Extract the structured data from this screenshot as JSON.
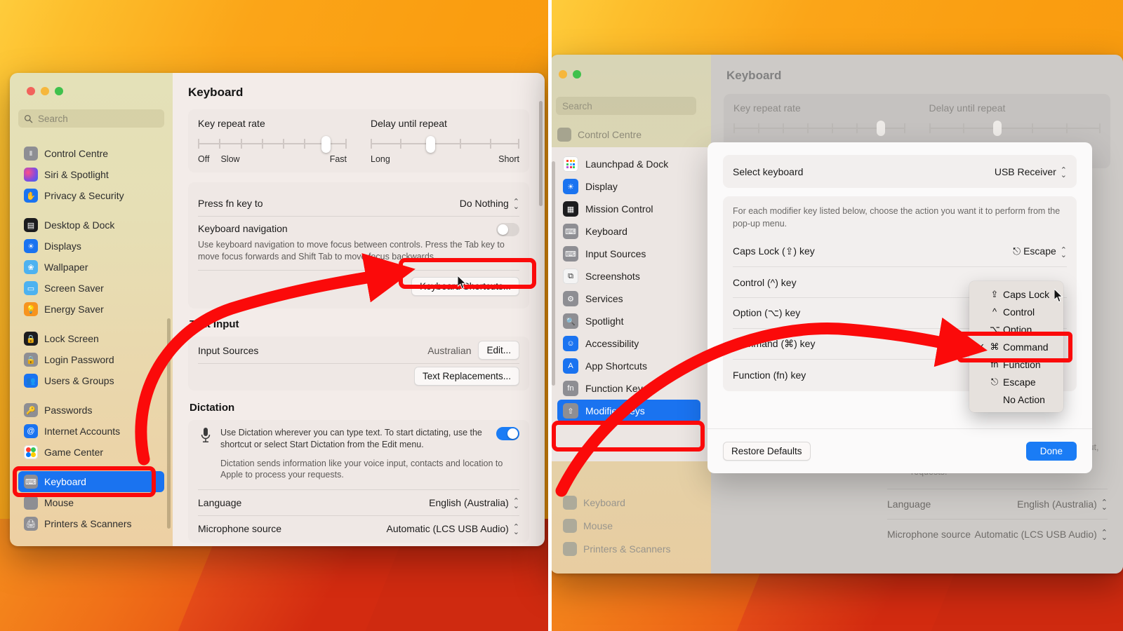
{
  "left_window": {
    "search": {
      "placeholder": "Search"
    },
    "sidebar_items": [
      {
        "label": "Control Centre",
        "icon": "control-centre-icon",
        "color": "#8e8e93"
      },
      {
        "label": "Siri & Spotlight",
        "icon": "siri-icon",
        "color": "#7a4fd8"
      },
      {
        "label": "Privacy & Security",
        "icon": "privacy-hand-icon",
        "color": "#1a73f0"
      },
      {
        "label": "Desktop & Dock",
        "icon": "desktop-dock-icon",
        "color": "#1c1c1e"
      },
      {
        "label": "Displays",
        "icon": "displays-icon",
        "color": "#1a73f0"
      },
      {
        "label": "Wallpaper",
        "icon": "wallpaper-icon",
        "color": "#4db2f0"
      },
      {
        "label": "Screen Saver",
        "icon": "screen-saver-icon",
        "color": "#4db2f0"
      },
      {
        "label": "Energy Saver",
        "icon": "energy-saver-icon",
        "color": "#f7941e"
      },
      {
        "label": "Lock Screen",
        "icon": "lock-screen-icon",
        "color": "#1c1c1e"
      },
      {
        "label": "Login Password",
        "icon": "login-password-icon",
        "color": "#8e8e93"
      },
      {
        "label": "Users & Groups",
        "icon": "users-groups-icon",
        "color": "#1a73f0"
      },
      {
        "label": "Passwords",
        "icon": "passwords-key-icon",
        "color": "#8e8e93"
      },
      {
        "label": "Internet Accounts",
        "icon": "internet-accounts-icon",
        "color": "#1a73f0"
      },
      {
        "label": "Game Center",
        "icon": "game-center-icon",
        "color": "#ffffff"
      },
      {
        "label": "Keyboard",
        "icon": "keyboard-icon",
        "color": "#8e8e93",
        "selected": true
      },
      {
        "label": "Mouse",
        "icon": "mouse-icon",
        "color": "#8e8e93"
      },
      {
        "label": "Printers & Scanners",
        "icon": "printers-scanners-icon",
        "color": "#8e8e93"
      }
    ],
    "page_title": "Keyboard",
    "key_repeat": {
      "title": "Key repeat rate",
      "ticks": 8,
      "thumb_index": 6,
      "label_off": "Off",
      "label_slow": "Slow",
      "label_fast": "Fast"
    },
    "delay_repeat": {
      "title": "Delay until repeat",
      "ticks": 6,
      "thumb_index": 2,
      "label_long": "Long",
      "label_short": "Short"
    },
    "press_fn": {
      "label": "Press fn key to",
      "value": "Do Nothing"
    },
    "keyboard_navigation": {
      "label": "Keyboard navigation",
      "description": "Use keyboard navigation to move focus between controls. Press the Tab key to move focus forwards and Shift Tab to move focus backwards.",
      "toggle_state": "off"
    },
    "keyboard_shortcuts_button": "Keyboard Shortcuts...",
    "text_input": {
      "heading": "Text Input",
      "input_sources_label": "Input Sources",
      "input_sources_value": "Australian",
      "edit_button": "Edit...",
      "text_replacements_button": "Text Replacements..."
    },
    "dictation": {
      "heading": "Dictation",
      "description": "Use Dictation wherever you can type text. To start dictating, use the shortcut or select Start Dictation from the Edit menu.",
      "privacy_note": "Dictation sends information like your voice input, contacts and location to Apple to process your requests.",
      "toggle_state": "on",
      "language_label": "Language",
      "language_value": "English (Australia)",
      "mic_label": "Microphone source",
      "mic_value": "Automatic (LCS USB Audio)"
    }
  },
  "right_window": {
    "search": {
      "placeholder": "Search"
    },
    "dim_sidebar_top": "Control Centre",
    "dim_sidebar_bottom": [
      "Keyboard",
      "Mouse",
      "Printers & Scanners"
    ],
    "page_title": "Keyboard",
    "key_repeat_title": "Key repeat rate",
    "delay_repeat_title": "Delay until repeat",
    "background_bottom": {
      "privacy_note": "Dictation sends information like your voice input, contacts and location to Apple to process your requests.",
      "language_label": "Language",
      "language_value": "English (Australia)",
      "mic_label": "Microphone source",
      "mic_value": "Automatic (LCS USB Audio)"
    },
    "category_items": [
      {
        "label": "Launchpad & Dock",
        "icon": "launchpad-dock-icon",
        "color": "#ffffff"
      },
      {
        "label": "Display",
        "icon": "display-icon",
        "color": "#1a73f0"
      },
      {
        "label": "Mission Control",
        "icon": "mission-control-icon",
        "color": "#1c1c1e"
      },
      {
        "label": "Keyboard",
        "icon": "keyboard-icon",
        "color": "#8e8e93"
      },
      {
        "label": "Input Sources",
        "icon": "input-sources-icon",
        "color": "#8e8e93"
      },
      {
        "label": "Screenshots",
        "icon": "screenshots-icon",
        "color": "#f2f2f2"
      },
      {
        "label": "Services",
        "icon": "services-gear-icon",
        "color": "#8e8e93"
      },
      {
        "label": "Spotlight",
        "icon": "spotlight-search-icon",
        "color": "#8e8e93"
      },
      {
        "label": "Accessibility",
        "icon": "accessibility-icon",
        "color": "#1a73f0"
      },
      {
        "label": "App Shortcuts",
        "icon": "app-store-icon",
        "color": "#1a73f0"
      },
      {
        "label": "Function Keys",
        "icon": "fn-icon",
        "color": "#8e8e93"
      },
      {
        "label": "Modifier Keys",
        "icon": "modifier-keys-icon",
        "color": "#8e8e93",
        "selected": true
      }
    ],
    "modifier_dialog": {
      "select_keyboard_label": "Select keyboard",
      "select_keyboard_value": "USB Receiver",
      "description": "For each modifier key listed below, choose the action you want it to perform from the pop-up menu.",
      "rows": [
        {
          "label": "Caps Lock (⇪) key",
          "value": "⎋ Escape",
          "has_value": true
        },
        {
          "label": "Control (^) key",
          "value": "",
          "has_value": false
        },
        {
          "label": "Option (⌥) key",
          "value": "",
          "has_value": false
        },
        {
          "label": "Command (⌘) key",
          "value": "",
          "has_value": false
        },
        {
          "label": "Function (fn) key",
          "value": "",
          "has_value": false
        }
      ],
      "restore_defaults_button": "Restore Defaults",
      "done_button": "Done"
    },
    "popup_menu": {
      "items": [
        {
          "symbol": "⇪",
          "label": "Caps Lock",
          "checked": false
        },
        {
          "symbol": "^",
          "label": "Control",
          "checked": false
        },
        {
          "symbol": "⌥",
          "label": "Option",
          "checked": false
        },
        {
          "symbol": "⌘",
          "label": "Command",
          "checked": true
        },
        {
          "symbol": "fn",
          "label": "Function",
          "checked": false
        },
        {
          "symbol": "⎋",
          "label": "Escape",
          "checked": false
        },
        {
          "symbol": "",
          "label": "No Action",
          "checked": false
        }
      ]
    }
  },
  "annotations": {
    "highlight_color": "#fb0a0a",
    "highlights": [
      "sidebar-keyboard-highlight",
      "keyboard-shortcuts-button-highlight",
      "modifier-keys-highlight",
      "command-menu-item-highlight"
    ],
    "arrows": [
      "arrow-to-keyboard-shortcuts",
      "arrow-to-command-menu-item"
    ]
  }
}
